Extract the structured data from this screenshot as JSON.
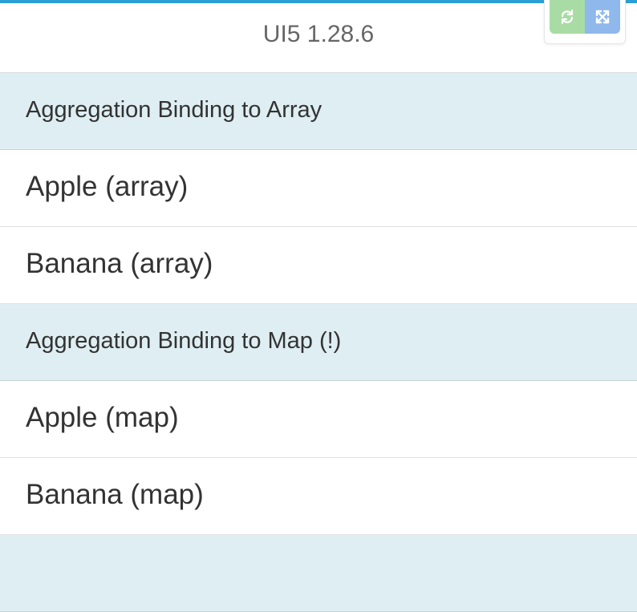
{
  "header": {
    "title": "UI5 1.28.6"
  },
  "toolbar": {
    "refresh_icon": "refresh-icon",
    "expand_icon": "fullscreen-icon",
    "refresh_color": "#a8dca4",
    "expand_color": "#8fb8ec"
  },
  "colors": {
    "accent_bar": "#2a9fd6",
    "group_header_bg": "#deeef2"
  },
  "list": {
    "groups": [
      {
        "title": "Aggregation Binding to Array",
        "items": [
          "Apple (array)",
          "Banana (array)"
        ]
      },
      {
        "title": "Aggregation Binding to Map (!)",
        "items": [
          "Apple (map)",
          "Banana (map)"
        ]
      }
    ]
  }
}
